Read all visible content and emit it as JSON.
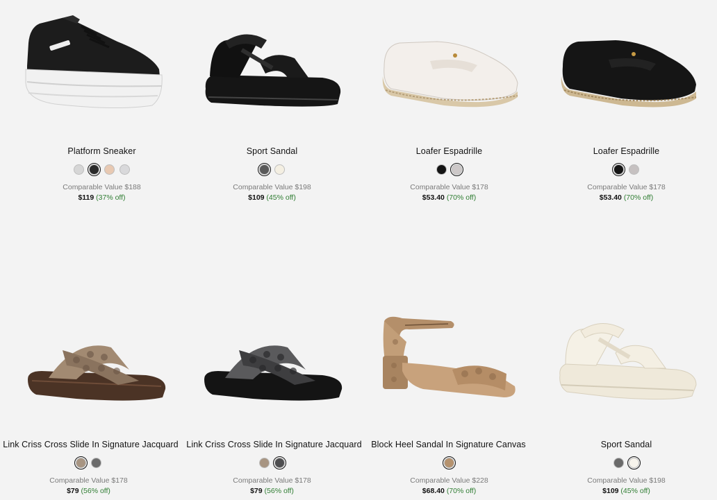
{
  "products": [
    {
      "name": "Platform Sneaker",
      "swatches": [
        {
          "color": "#d6d6d6",
          "selected": false
        },
        {
          "color": "#2a2a2a",
          "selected": true
        },
        {
          "color": "#e8c9b2",
          "selected": false
        },
        {
          "color": "#d9d9db",
          "selected": false
        }
      ],
      "comparable": "Comparable Value $188",
      "price": "$119",
      "discount": "(37% off)",
      "image": "platform-sneaker-black"
    },
    {
      "name": "Sport Sandal",
      "swatches": [
        {
          "color": "#5a5a5a",
          "selected": true
        },
        {
          "color": "#f4efe2",
          "selected": false
        }
      ],
      "comparable": "Comparable Value $198",
      "price": "$109",
      "discount": "(45% off)",
      "image": "sport-sandal-black"
    },
    {
      "name": "Loafer Espadrille",
      "swatches": [
        {
          "color": "#141414",
          "selected": false
        },
        {
          "color": "#cdc8c8",
          "selected": true
        }
      ],
      "comparable": "Comparable Value $178",
      "price": "$53.40",
      "discount": "(70% off)",
      "image": "loafer-espadrille-chalk"
    },
    {
      "name": "Loafer Espadrille",
      "swatches": [
        {
          "color": "#141414",
          "selected": true
        },
        {
          "color": "#c6c1c1",
          "selected": false
        }
      ],
      "comparable": "Comparable Value $178",
      "price": "$53.40",
      "discount": "(70% off)",
      "image": "loafer-espadrille-black"
    },
    {
      "name": "Link Criss Cross Slide In Signature Jacquard",
      "swatches": [
        {
          "color": "#a89582",
          "selected": true
        },
        {
          "color": "#6c6c6c",
          "selected": false
        }
      ],
      "comparable": "Comparable Value $178",
      "price": "$79",
      "discount": "(56% off)",
      "image": "slide-jacquard-khaki"
    },
    {
      "name": "Link Criss Cross Slide In Signature Jacquard",
      "swatches": [
        {
          "color": "#a89582",
          "selected": false
        },
        {
          "color": "#4e4e50",
          "selected": true
        }
      ],
      "comparable": "Comparable Value $178",
      "price": "$79",
      "discount": "(56% off)",
      "image": "slide-jacquard-charcoal"
    },
    {
      "name": "Block Heel Sandal In Signature Canvas",
      "swatches": [
        {
          "color": "#b5926e",
          "selected": true
        }
      ],
      "comparable": "Comparable Value $228",
      "price": "$68.40",
      "discount": "(70% off)",
      "image": "block-heel-sandal-tan"
    },
    {
      "name": "Sport Sandal",
      "swatches": [
        {
          "color": "#6a6a6a",
          "selected": false
        },
        {
          "color": "#f7f4ec",
          "selected": true
        }
      ],
      "comparable": "Comparable Value $198",
      "price": "$109",
      "discount": "(45% off)",
      "image": "sport-sandal-chalk"
    }
  ]
}
